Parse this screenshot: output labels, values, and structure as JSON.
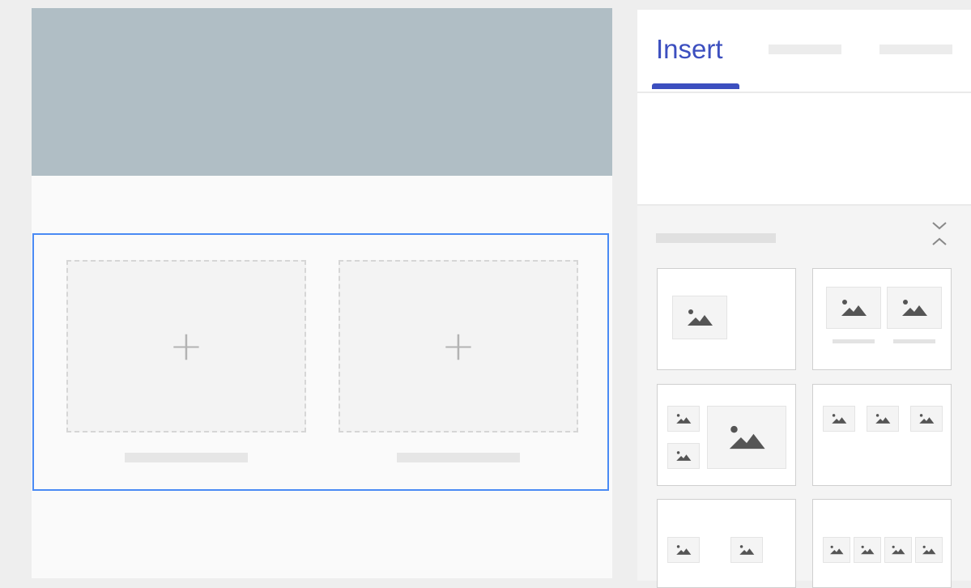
{
  "colors": {
    "banner": "#b0bec5",
    "accent": "#3c4fbf",
    "selection": "#4a8af4"
  },
  "canvas": {
    "columns": [
      {
        "add_glyph": "+"
      },
      {
        "add_glyph": "+"
      }
    ]
  },
  "panel": {
    "tabs": [
      {
        "label": "Insert",
        "selected": true
      },
      {
        "label": "",
        "selected": false
      },
      {
        "label": "",
        "selected": false
      }
    ],
    "chevron_down": "⌄",
    "chevron_up": "⌃",
    "layouts": [
      {
        "name": "one-image"
      },
      {
        "name": "two-images-with-captions"
      },
      {
        "name": "two-small-one-large"
      },
      {
        "name": "three-images-row"
      },
      {
        "name": "two-images-row"
      },
      {
        "name": "four-images-row"
      }
    ],
    "icons": [
      "image-icon",
      "plus-icon",
      "chevron-down-icon",
      "chevron-up-icon"
    ]
  }
}
